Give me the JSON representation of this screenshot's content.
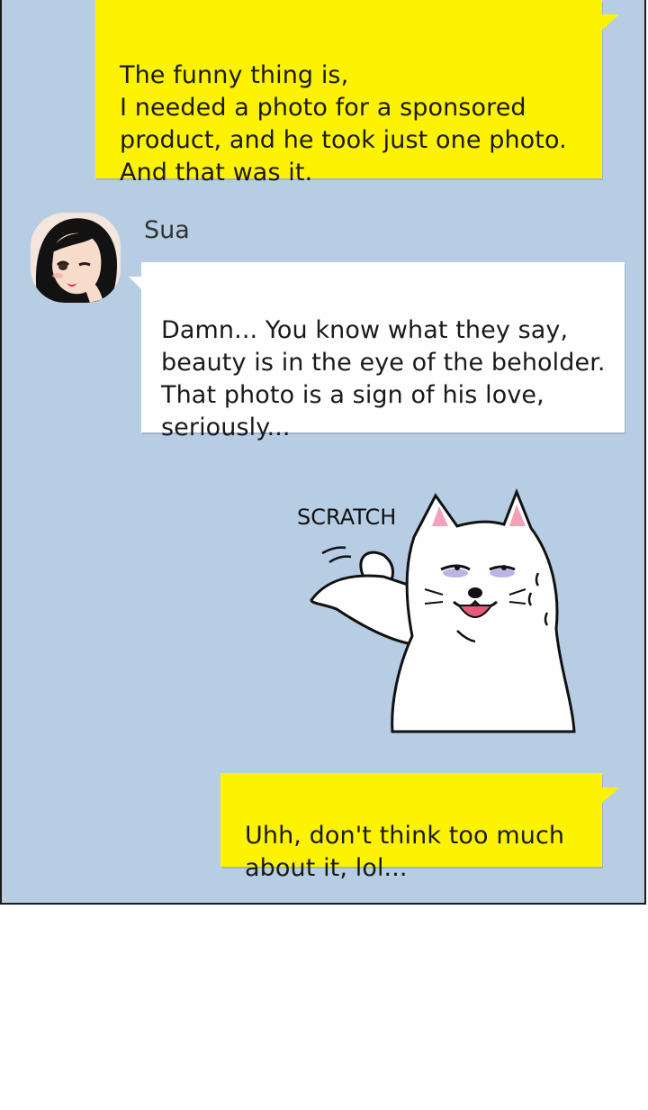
{
  "chat": {
    "messages": [
      {
        "sender": "me",
        "text": "The funny thing is,\nI needed a photo for a sponsored\nproduct, and he took just one photo.\nAnd that was it."
      },
      {
        "sender": "Sua",
        "text": "Damn... You know what they say,\nbeauty is in the eye of the beholder.\nThat photo is a sign of his love,\nseriously..."
      },
      {
        "sender": "me",
        "text": "Uhh, don't think too much\nabout it, lol..."
      }
    ],
    "sticker": {
      "sound_effect": "SCRATCH",
      "icon": "cat-scratching-head-sticker"
    }
  },
  "colors": {
    "background": "#b6cde4",
    "my_bubble": "#fdf200",
    "their_bubble": "#ffffff"
  }
}
